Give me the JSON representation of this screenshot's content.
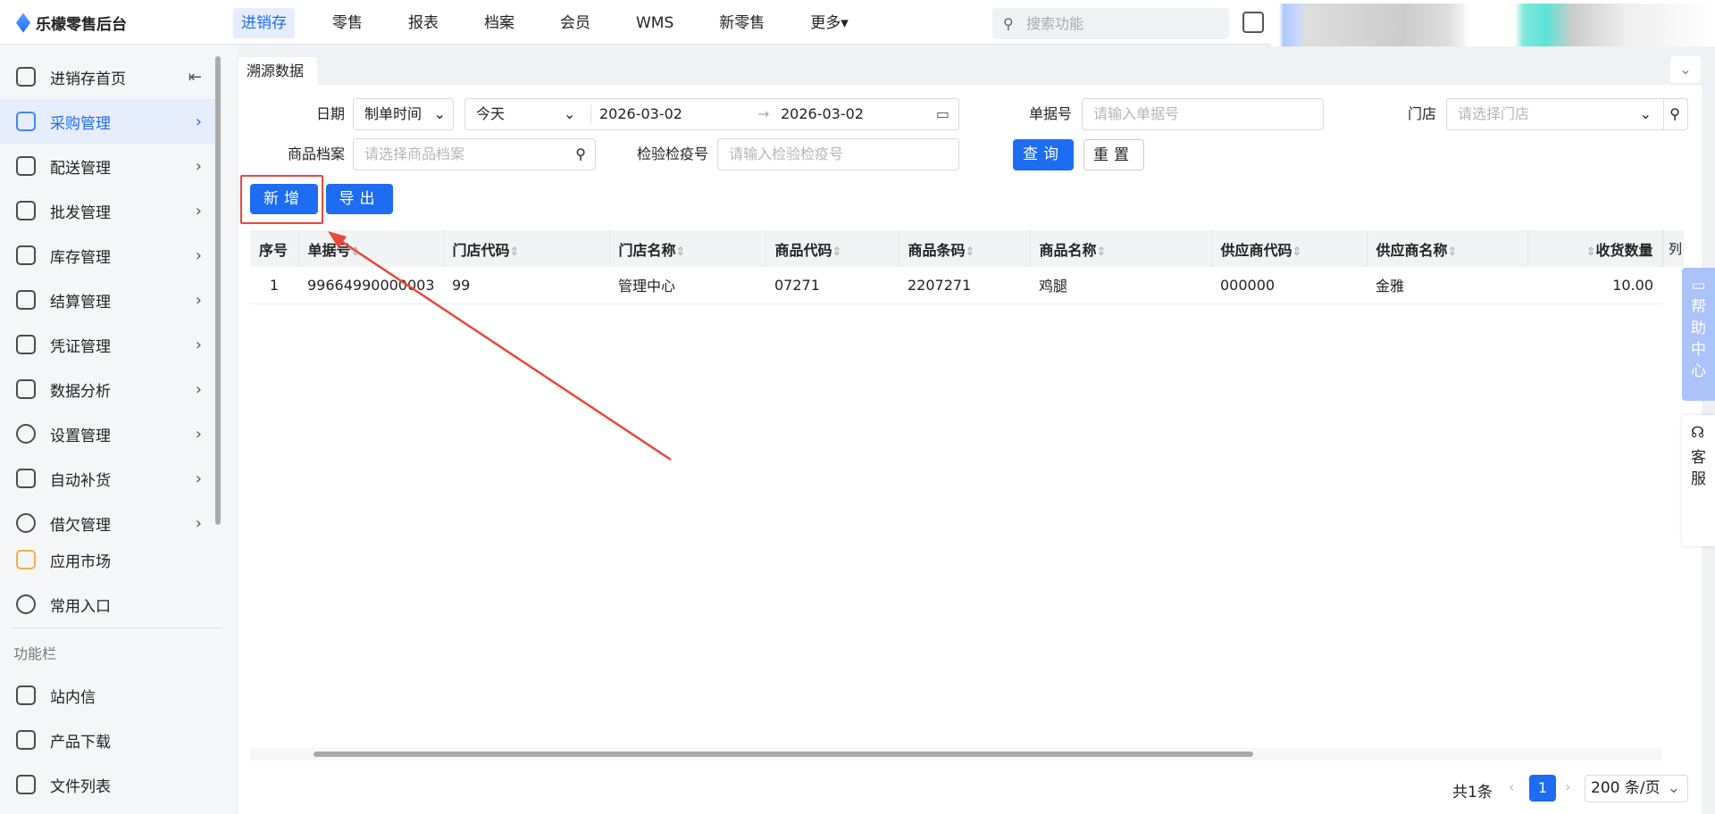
{
  "header": {
    "brand": "乐檬零售后台",
    "nav": [
      "进销存",
      "零售",
      "报表",
      "档案",
      "会员",
      "WMS",
      "新零售",
      "更多▾"
    ],
    "search_placeholder": "搜索功能"
  },
  "sidebar": {
    "items": [
      "进销存首页",
      "采购管理",
      "配送管理",
      "批发管理",
      "库存管理",
      "结算管理",
      "凭证管理",
      "数据分析",
      "设置管理",
      "自动补货",
      "借欠管理"
    ],
    "extra": [
      "应用市场",
      "常用入口"
    ],
    "section_label": "功能栏",
    "tools": [
      "站内信",
      "产品下载",
      "文件列表"
    ]
  },
  "tab": "溯源数据",
  "filters": {
    "date_label": "日期",
    "date_type": "制单时间",
    "period": "今天",
    "start": "2026-03-02",
    "end": "2026-03-02",
    "order_label": "单据号",
    "order_ph": "请输入单据号",
    "store_label": "门店",
    "store_ph": "请选择门店",
    "product_label": "商品档案",
    "product_ph": "请选择商品档案",
    "quarantine_label": "检验检疫号",
    "quarantine_ph": "请输入检验检疫号",
    "query": "查询",
    "reset": "重置"
  },
  "actions": {
    "add": "新增",
    "export": "导出"
  },
  "table": {
    "columns": [
      "序号",
      "单据号",
      "门店代码",
      "门店名称",
      "商品代码",
      "商品条码",
      "商品名称",
      "供应商代码",
      "供应商名称",
      "收货数量"
    ],
    "col_setting": "列",
    "rows": [
      [
        "1",
        "99664990000003",
        "99",
        "管理中心",
        "07271",
        "2207271",
        "鸡腿",
        "000000",
        "金雅",
        "10.00"
      ]
    ]
  },
  "pagination": {
    "total": "共1条",
    "page": "1",
    "size": "200 条/页"
  },
  "float": {
    "help": "帮助中心",
    "service": "客服"
  },
  "colors": {
    "accent": "#1d6cf2",
    "highlight": "#e8483b"
  }
}
